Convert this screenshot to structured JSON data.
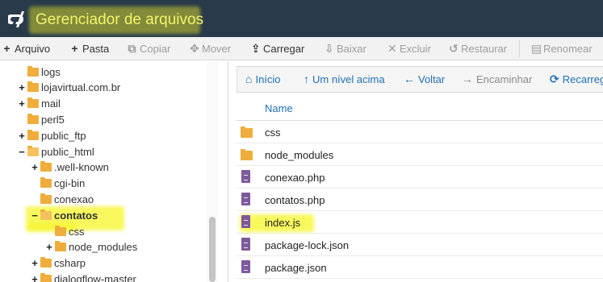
{
  "app": {
    "title": "Gerenciador de arquivos",
    "logo_icon": "cpanel-logo-icon"
  },
  "toolbar": [
    {
      "label": "Arquivo",
      "icon": "+",
      "disabled": false
    },
    {
      "label": "Pasta",
      "icon": "+",
      "disabled": false
    },
    {
      "label": "Copiar",
      "icon": "⧉",
      "disabled": true
    },
    {
      "label": "Mover",
      "icon": "✥",
      "disabled": true
    },
    {
      "label": "Carregar",
      "icon": "⇪",
      "disabled": false
    },
    {
      "label": "Baixar",
      "icon": "⇩",
      "disabled": true
    },
    {
      "label": "Excluir",
      "icon": "✕",
      "disabled": true
    },
    {
      "label": "Restaurar",
      "icon": "↺",
      "disabled": true
    },
    {
      "label": "Renomear",
      "icon": "▤",
      "disabled": true
    }
  ],
  "tree": [
    {
      "label": "logs",
      "toggle": ""
    },
    {
      "label": "lojavirtual.com.br",
      "toggle": "+"
    },
    {
      "label": "mail",
      "toggle": "+"
    },
    {
      "label": "perl5",
      "toggle": ""
    },
    {
      "label": "public_ftp",
      "toggle": "+"
    },
    {
      "label": "public_html",
      "toggle": "−"
    },
    {
      "label": ".well-known",
      "toggle": "+"
    },
    {
      "label": "cgi-bin",
      "toggle": ""
    },
    {
      "label": "conexao",
      "toggle": ""
    },
    {
      "label": "contatos",
      "toggle": "−"
    },
    {
      "label": "css",
      "toggle": ""
    },
    {
      "label": "node_modules",
      "toggle": "+"
    },
    {
      "label": "csharp",
      "toggle": "+"
    },
    {
      "label": "dialogflow-master",
      "toggle": "+"
    }
  ],
  "nav": [
    {
      "label": "Início",
      "icon": "⌂",
      "disabled": false
    },
    {
      "label": "Um nível acima",
      "icon": "↑",
      "disabled": false
    },
    {
      "label": "Voltar",
      "icon": "←",
      "disabled": false
    },
    {
      "label": "Encaminhar",
      "icon": "→",
      "disabled": true
    },
    {
      "label": "Recarregar",
      "icon": "⟳",
      "disabled": false
    }
  ],
  "files": {
    "column_name": "Name",
    "rows": [
      {
        "name": "css",
        "type": "folder"
      },
      {
        "name": "node_modules",
        "type": "folder"
      },
      {
        "name": "conexao.php",
        "type": "file"
      },
      {
        "name": "contatos.php",
        "type": "file"
      },
      {
        "name": "index.js",
        "type": "file"
      },
      {
        "name": "package-lock.json",
        "type": "file"
      },
      {
        "name": "package.json",
        "type": "file"
      }
    ]
  },
  "colors": {
    "header_bg": "#293a4a",
    "link": "#1e6fb4",
    "folder": "#f0ad3c",
    "file_icon": "#7e5a9b",
    "highlight": "#f5f528"
  }
}
